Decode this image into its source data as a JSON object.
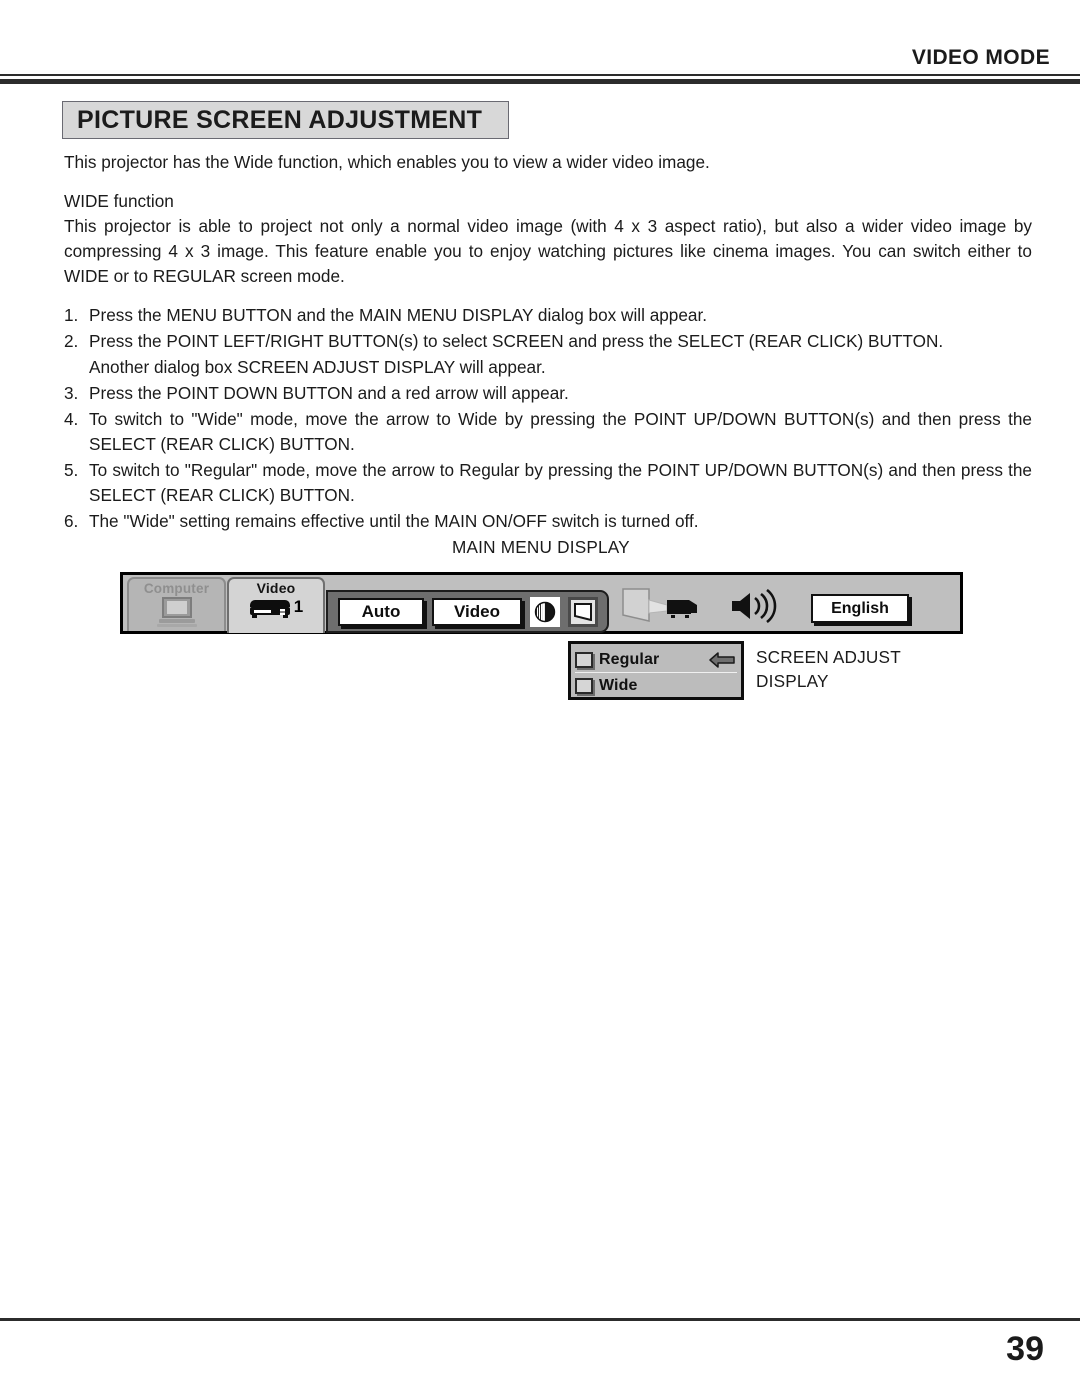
{
  "header": {
    "mode_label": "VIDEO MODE"
  },
  "title": {
    "text": "PICTURE SCREEN ADJUSTMENT"
  },
  "body": {
    "intro": "This projector has the Wide function, which enables you to view a wider video image.",
    "section_heading": "WIDE function",
    "section_body": "This projector is able to project not only a normal video image (with 4 x 3 aspect ratio), but also a wider video image by compressing 4 x 3 image. This feature enable you to enjoy watching pictures like cinema images. You can switch either to WIDE or to REGULAR screen mode.",
    "steps": [
      {
        "num": "1.",
        "text": "Press the MENU BUTTON and the MAIN MENU DISPLAY dialog box will appear."
      },
      {
        "num": "2.",
        "text": "Press the POINT LEFT/RIGHT BUTTON(s) to select SCREEN and press the SELECT (REAR CLICK) BUTTON.",
        "continuation": "Another dialog box SCREEN ADJUST DISPLAY will appear."
      },
      {
        "num": "3.",
        "text": "Press the POINT DOWN BUTTON and a red arrow will appear."
      },
      {
        "num": "4.",
        "text": "To switch to \"Wide\" mode, move the arrow to Wide by pressing the POINT UP/DOWN BUTTON(s) and then press the SELECT (REAR CLICK) BUTTON."
      },
      {
        "num": "5.",
        "text": "To switch to \"Regular\" mode, move the arrow to Regular by pressing the POINT UP/DOWN BUTTON(s) and then press the SELECT (REAR CLICK) BUTTON."
      },
      {
        "num": "6.",
        "text": "The \"Wide\" setting remains effective until the MAIN ON/OFF switch is turned off."
      }
    ]
  },
  "figure": {
    "main_menu_caption": "MAIN MENU DISPLAY",
    "screen_label": "SCREEN",
    "tabs": {
      "computer": {
        "label": "Computer",
        "icon": "computer-monitor-icon"
      },
      "video": {
        "label": "Video",
        "numeral": "1",
        "icon": "vcr-icon"
      }
    },
    "buttons": {
      "auto": "Auto",
      "video": "Video",
      "contrast_icon": "contrast-circle-icon",
      "screen_icon": "screen-trapezoid-icon"
    },
    "right_icons": {
      "projector_icon": "projector-icon",
      "volume_icon": "speaker-volume-icon",
      "language": "English"
    },
    "adjust_dialog": {
      "options": [
        {
          "label": "Regular",
          "icon": "checkbox-regular-icon",
          "selected": true
        },
        {
          "label": "Wide",
          "icon": "checkbox-wide-icon",
          "selected": false
        }
      ],
      "arrow_icon": "arrow-left-icon"
    },
    "adjust_caption_line1": "SCREEN ADJUST",
    "adjust_caption_line2": "DISPLAY"
  },
  "footer": {
    "page_number": "39"
  }
}
